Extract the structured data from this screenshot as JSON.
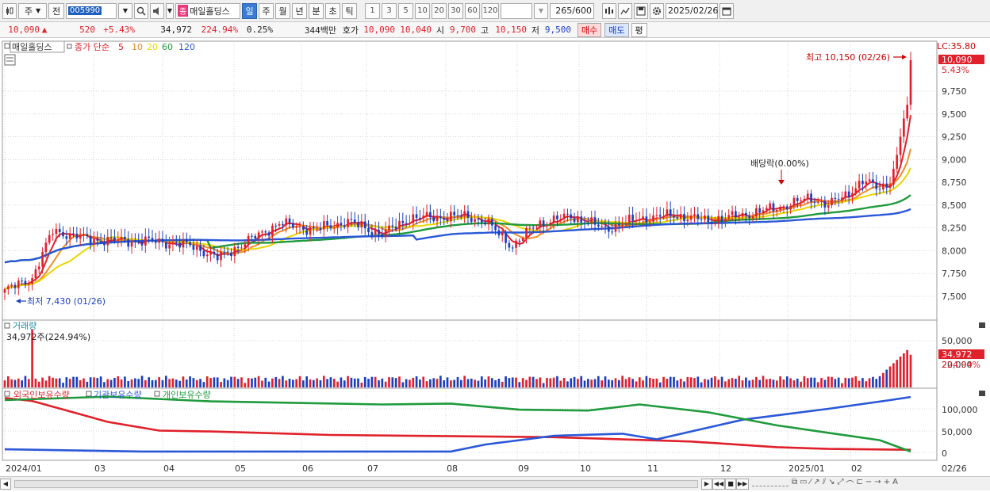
{
  "toolbar": {
    "chart_icon": "candlestick-icon",
    "type": "주",
    "pre": "전",
    "code": "005990",
    "stock_name_badge": "종",
    "stock_name": "매일홀딩스",
    "periods": [
      "일",
      "주",
      "월",
      "년",
      "분",
      "초",
      "틱"
    ],
    "active_period": "일",
    "nums": [
      "1",
      "3",
      "5",
      "10",
      "20",
      "30",
      "60",
      "120"
    ],
    "count": "265",
    "total": "/600",
    "date": "2025/02/26"
  },
  "quote": {
    "price": "10,090",
    "change": "520",
    "change_pct": "+5.43%",
    "volume": "34,972",
    "vol_ratio": "224.94%",
    "turnover": "0.25%",
    "amount": "344백만",
    "hoga_label": "호가",
    "ask": "10,090",
    "bid": "10,040",
    "open_label": "시",
    "open": "9,700",
    "high_label": "고",
    "high": "10,150",
    "low_label": "저",
    "low": "9,500",
    "buy": "매수",
    "sell": "매도",
    "pyeong": "평"
  },
  "price_panel": {
    "legend_name": "매일홀딩스",
    "legend_ma": "종가 단순",
    "ma_periods": [
      {
        "label": "5",
        "color": "#e0202a"
      },
      {
        "label": "10",
        "color": "#f08c28"
      },
      {
        "label": "20",
        "color": "#e8d600"
      },
      {
        "label": "60",
        "color": "#1f9a3c"
      },
      {
        "label": "120",
        "color": "#2a58d8"
      }
    ],
    "lc": "LC:35.80",
    "current_tag": "10,090",
    "pct_tag": "5.43%",
    "high_ann": "최고 10,150 (02/26)",
    "low_ann": "최저 7,430 (01/26)",
    "dividend": "배당락(0.00%)",
    "ticks": [
      "9,750",
      "9,500",
      "9,250",
      "9,000",
      "8,750",
      "8,500",
      "8,250",
      "8,000",
      "7,750",
      "7,500"
    ]
  },
  "volume_panel": {
    "title": "거래량",
    "value": "34,972주(224.94%)",
    "ticks": [
      "50,000",
      "20,000"
    ],
    "tag": "34,972",
    "tag_pct": "224.94%"
  },
  "holding_panel": {
    "foreign": "외국인보유수량",
    "inst": "기관보유수량",
    "indiv": "개인보유수량",
    "ticks": [
      "100,000",
      "50,000",
      "0"
    ]
  },
  "xaxis": [
    "2024/01",
    "03",
    "04",
    "05",
    "06",
    "07",
    "08",
    "09",
    "10",
    "11",
    "12",
    "2025/01",
    "02"
  ],
  "xaxis_last": "02/26",
  "colors": {
    "up": "#e0202a",
    "down": "#1a3fc0",
    "ma5": "#e0202a",
    "ma10": "#f08c28",
    "ma20": "#e8d600",
    "ma60": "#1f9a3c",
    "ma120": "#2a58d8"
  }
}
